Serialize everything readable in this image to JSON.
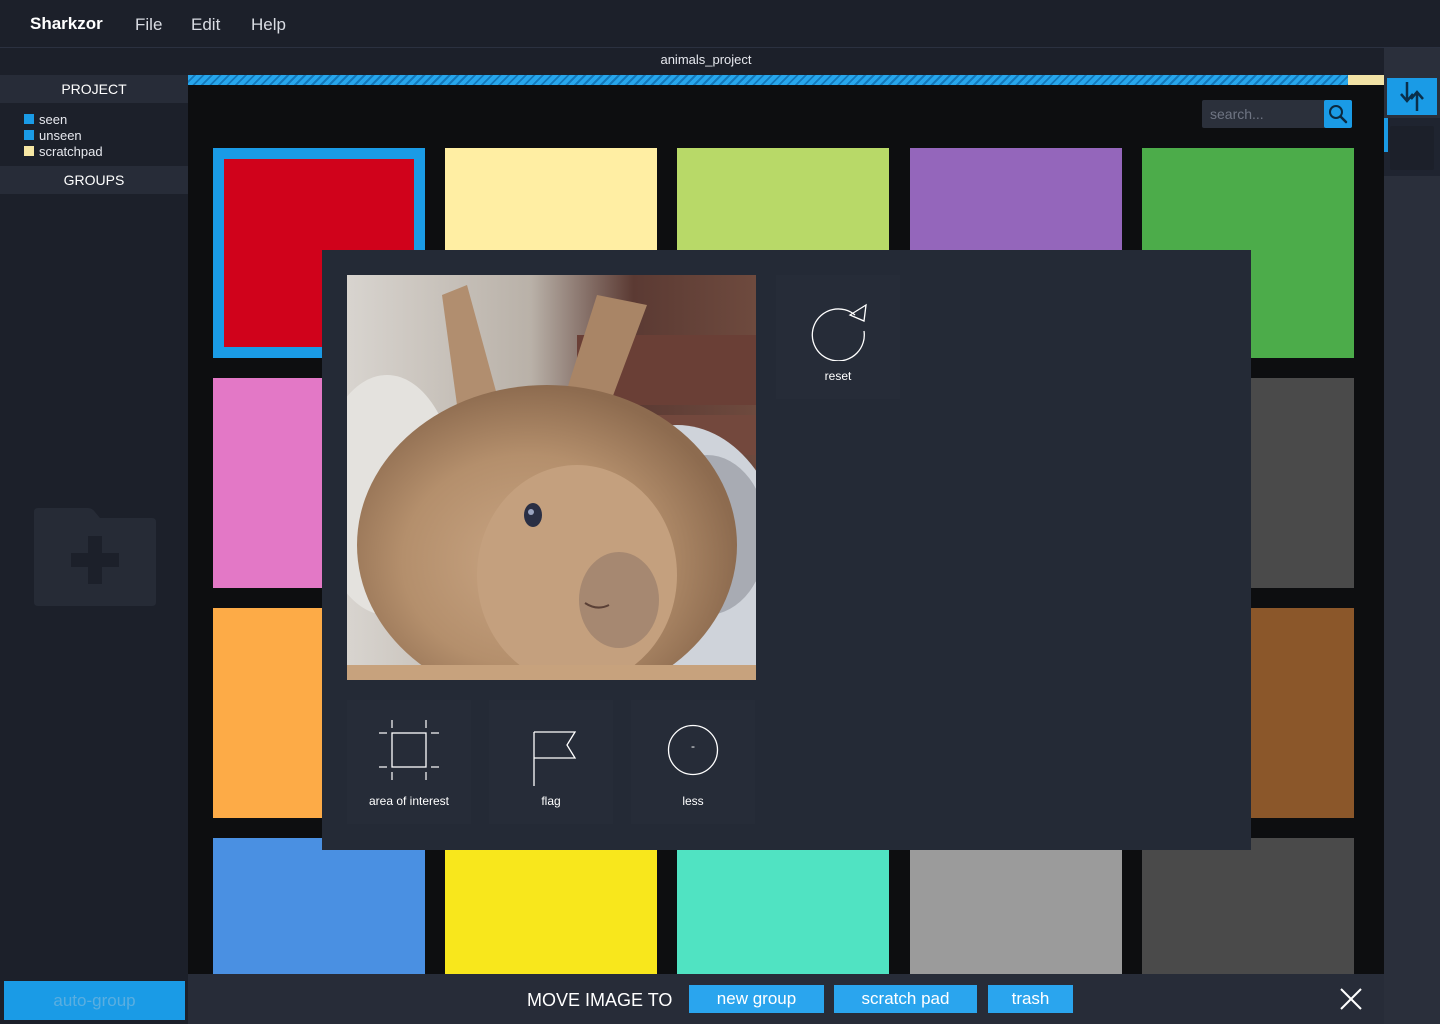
{
  "app": {
    "name": "Sharkzor"
  },
  "menu": [
    {
      "label": "File"
    },
    {
      "label": "Edit"
    },
    {
      "label": "Help"
    }
  ],
  "sidebar": {
    "project_heading": "PROJECT",
    "legend": [
      {
        "label": "seen",
        "color": "#1a9be6"
      },
      {
        "label": "unseen",
        "color": "#1a9be6"
      },
      {
        "label": "scratchpad",
        "color": "#f6e7a4"
      }
    ],
    "groups_heading": "GROUPS",
    "add_icon": "folder-plus-icon",
    "auto_group_label": "auto-group"
  },
  "project": {
    "title": "animals_project",
    "progress_fraction": 0.97
  },
  "search": {
    "placeholder": "search...",
    "icon": "search-icon"
  },
  "tiles": [
    {
      "color": "#d0021b",
      "selected": true
    },
    {
      "color": "#ffeea3"
    },
    {
      "color": "#b8d968"
    },
    {
      "color": "#9466bb"
    },
    {
      "color": "#4cac4a"
    },
    {
      "color": "#e378c6"
    },
    {
      "color": "#ffeea3"
    },
    {
      "color": "#b8d968"
    },
    {
      "color": "#9466bb"
    },
    {
      "color": "#4a4a4a"
    },
    {
      "color": "#fdab47"
    },
    {
      "color": "#ffeea3"
    },
    {
      "color": "#b8d968"
    },
    {
      "color": "#9466bb"
    },
    {
      "color": "#8b572a"
    },
    {
      "color": "#4a90e2"
    },
    {
      "color": "#f8e71c"
    },
    {
      "color": "#50e3c2"
    },
    {
      "color": "#9b9b9b"
    },
    {
      "color": "#4a4a4a"
    }
  ],
  "modal": {
    "tools": [
      {
        "label": "reset",
        "icon": "reset-icon"
      },
      {
        "label": "area of interest",
        "icon": "area-of-interest-icon"
      },
      {
        "label": "flag",
        "icon": "flag-icon"
      },
      {
        "label": "less",
        "icon": "less-icon",
        "glyph": "-"
      }
    ]
  },
  "bottom": {
    "move_label": "MOVE IMAGE TO",
    "new_group": "new group",
    "scratch_pad": "scratch pad",
    "trash": "trash",
    "close_icon": "close-icon"
  },
  "right": {
    "sort_icon": "sort-arrows-icon"
  },
  "colors": {
    "accent": "#1a9be6",
    "background": "#1c202a",
    "panel": "#242a36"
  }
}
